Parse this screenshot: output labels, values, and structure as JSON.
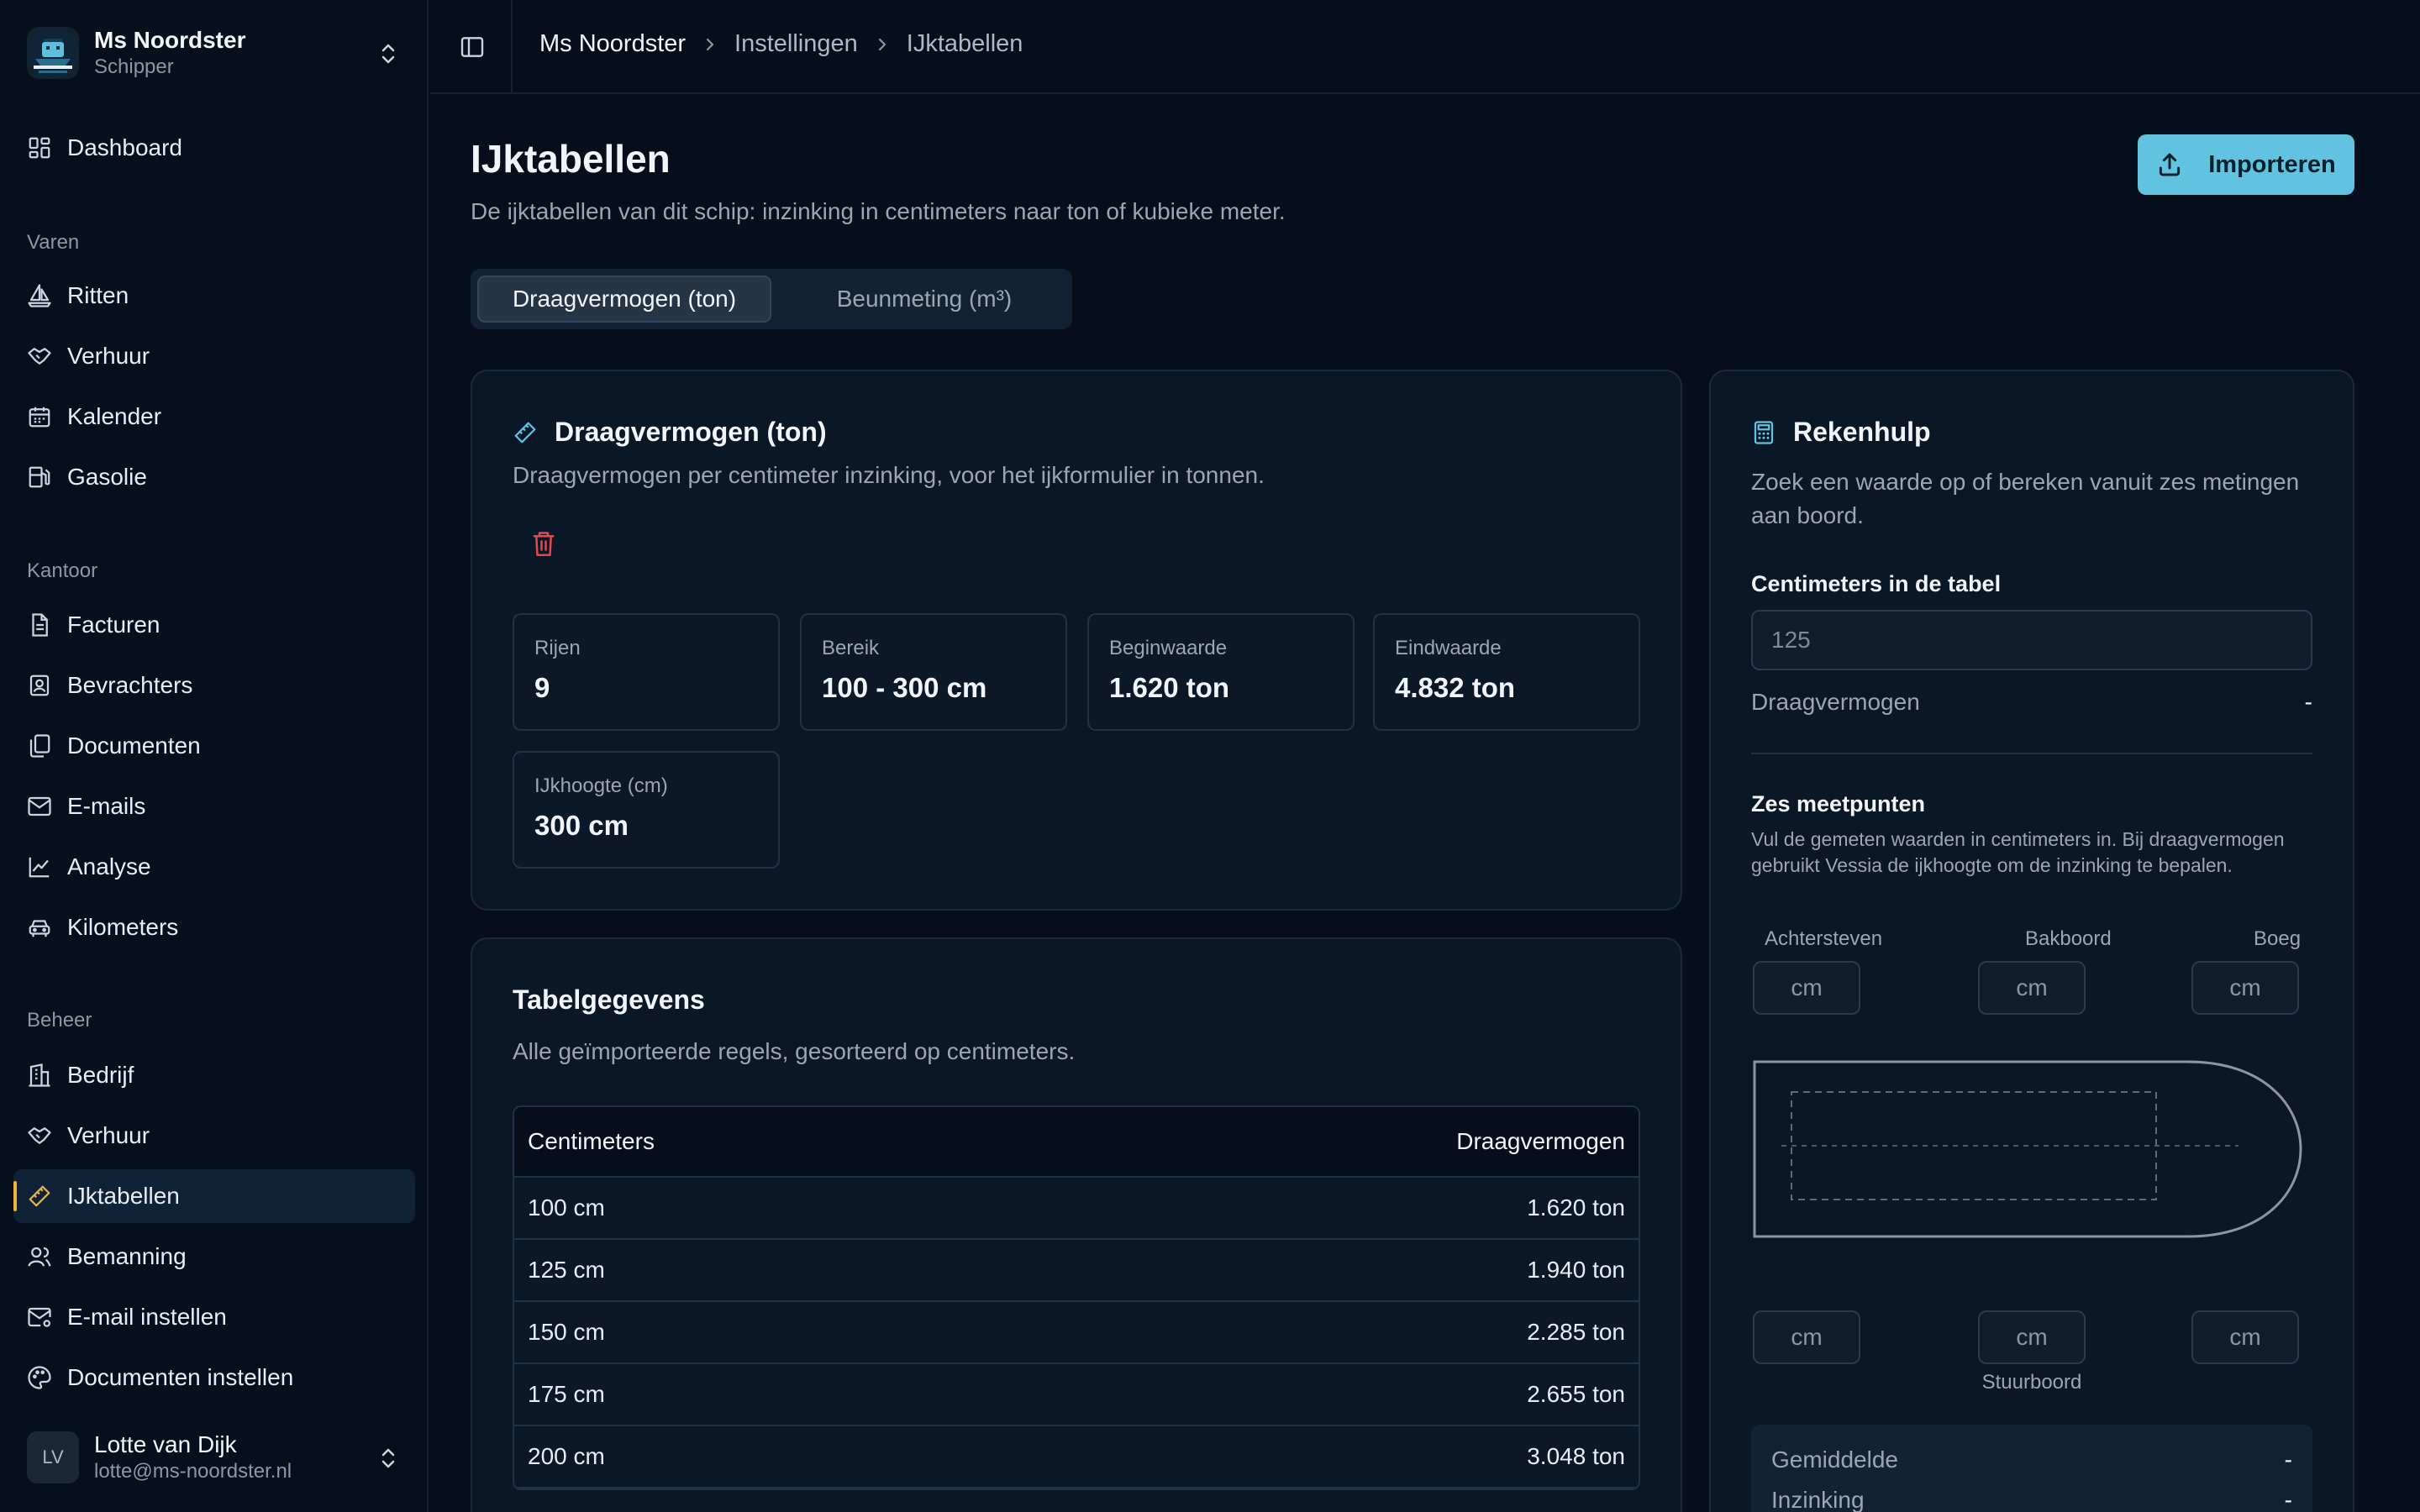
{
  "app": {
    "ship_name": "Ms Noordster",
    "ship_role": "Schipper"
  },
  "sidebar": {
    "top_items": [
      {
        "label": "Dashboard",
        "icon": "dashboard-icon"
      }
    ],
    "sections": [
      {
        "title": "Varen",
        "items": [
          {
            "label": "Ritten",
            "icon": "sailboat-icon"
          },
          {
            "label": "Verhuur",
            "icon": "handshake-icon"
          },
          {
            "label": "Kalender",
            "icon": "calendar-icon"
          },
          {
            "label": "Gasolie",
            "icon": "fuel-icon"
          }
        ]
      },
      {
        "title": "Kantoor",
        "items": [
          {
            "label": "Facturen",
            "icon": "invoice-icon"
          },
          {
            "label": "Bevrachters",
            "icon": "contact-icon"
          },
          {
            "label": "Documenten",
            "icon": "documents-icon"
          },
          {
            "label": "E-mails",
            "icon": "mail-icon"
          },
          {
            "label": "Analyse",
            "icon": "chart-line-icon"
          },
          {
            "label": "Kilometers",
            "icon": "car-icon"
          }
        ]
      },
      {
        "title": "Beheer",
        "items": [
          {
            "label": "Bedrijf",
            "icon": "building-icon"
          },
          {
            "label": "Verhuur",
            "icon": "handshake-icon"
          },
          {
            "label": "IJktabellen",
            "icon": "ruler-icon",
            "active": true
          },
          {
            "label": "Bemanning",
            "icon": "users-icon"
          },
          {
            "label": "E-mail instellen",
            "icon": "mail-settings-icon"
          },
          {
            "label": "Documenten instellen",
            "icon": "palette-icon"
          }
        ]
      }
    ],
    "user": {
      "initials": "LV",
      "name": "Lotte van Dijk",
      "email": "lotte@ms-noordster.nl"
    }
  },
  "topbar": {
    "breadcrumbs": [
      "Ms Noordster",
      "Instellingen",
      "IJktabellen"
    ]
  },
  "page": {
    "title": "IJktabellen",
    "subtitle": "De ijktabellen van dit schip: inzinking in centimeters naar ton of kubieke meter.",
    "import_label": "Importeren",
    "tabs": [
      "Draagvermogen (ton)",
      "Beunmeting (m³)"
    ],
    "active_tab": 0
  },
  "summary": {
    "title": "Draagvermogen (ton)",
    "description": "Draagvermogen per centimeter inzinking, voor het ijkformulier in tonnen.",
    "stats": [
      {
        "label": "Rijen",
        "value": "9"
      },
      {
        "label": "Bereik",
        "value": "100 - 300 cm"
      },
      {
        "label": "Beginwaarde",
        "value": "1.620 ton"
      },
      {
        "label": "Eindwaarde",
        "value": "4.832 ton"
      },
      {
        "label": "IJkhoogte (cm)",
        "value": "300 cm"
      }
    ]
  },
  "table": {
    "title": "Tabelgegevens",
    "description": "Alle geïmporteerde regels, gesorteerd op centimeters.",
    "columns": [
      "Centimeters",
      "Draagvermogen"
    ],
    "rows": [
      [
        "100 cm",
        "1.620 ton"
      ],
      [
        "125 cm",
        "1.940 ton"
      ],
      [
        "150 cm",
        "2.285 ton"
      ],
      [
        "175 cm",
        "2.655 ton"
      ],
      [
        "200 cm",
        "3.048 ton"
      ]
    ]
  },
  "calculator": {
    "title": "Rekenhulp",
    "description": "Zoek een waarde op of bereken vanuit zes metingen aan boord.",
    "lookup_label": "Centimeters in de tabel",
    "lookup_placeholder": "125",
    "result_label": "Draagvermogen",
    "result_value": "-",
    "six_title": "Zes meetpunten",
    "six_desc": "Vul de gemeten waarden in centimeters in. Bij draagvermogen gebruikt Vessia de ijkhoogte om de inzinking te bepalen.",
    "top_labels": [
      "Achtersteven",
      "Bakboord",
      "Boeg"
    ],
    "bottom_label": "Stuurboord",
    "unit_placeholder": "cm",
    "avg_label": "Gemiddelde",
    "avg_value": "-",
    "sink_label": "Inzinking",
    "sink_value": "-"
  },
  "colors": {
    "accent": "#61c3df",
    "active_marker": "#f0b43c",
    "danger": "#e5484d"
  }
}
